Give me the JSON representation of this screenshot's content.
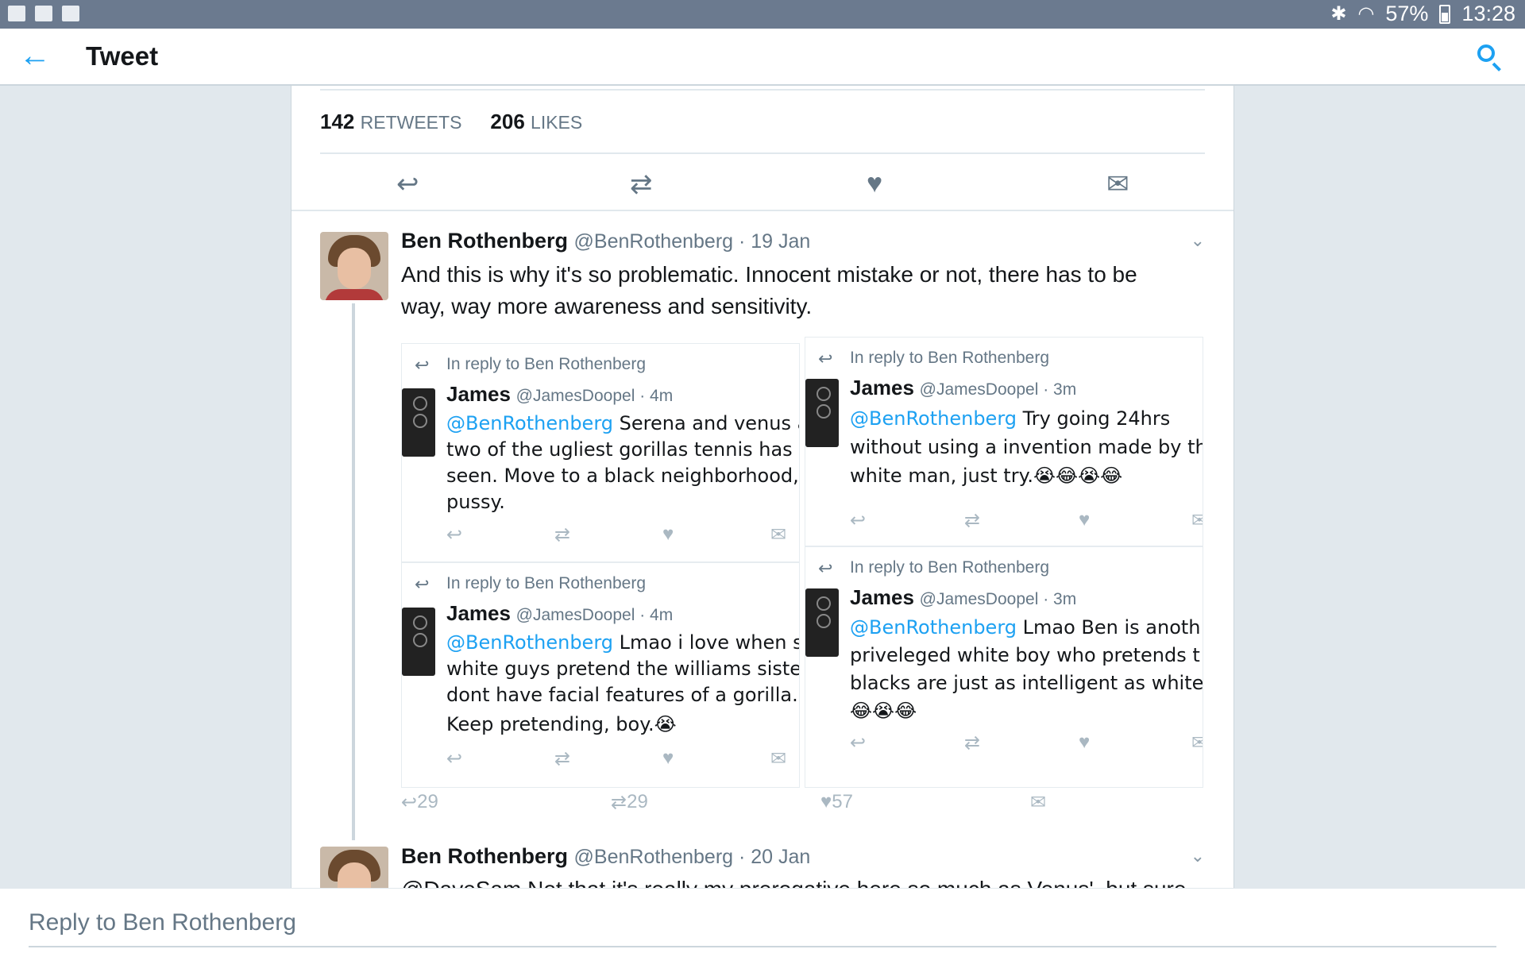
{
  "status_bar": {
    "battery": "57%",
    "time": "13:28"
  },
  "toolbar": {
    "title": "Tweet"
  },
  "stats": {
    "retweets_count": "142",
    "retweets_label": "RETWEETS",
    "likes_count": "206",
    "likes_label": "LIKES"
  },
  "reply_1": {
    "name": "Ben Rothenberg",
    "handle": "@BenRothenberg · 19 Jan",
    "text_line1": "And this is why it's so problematic. Innocent mistake or not, there has to be",
    "text_line2": "way, way more awareness and sensitivity.",
    "embedded": [
      {
        "reply_to": "In reply to Ben Rothenberg",
        "name": "James",
        "handle": "@JamesDoopel · 4m",
        "mention": "@BenRothenberg",
        "line1": " Serena and venus a",
        "line2": "two of the ugliest gorillas tennis has e",
        "line3": "seen. Move to a black neighborhood,",
        "line4": "pussy."
      },
      {
        "reply_to": "In reply to Ben Rothenberg",
        "name": "James",
        "handle": "@JamesDoopel · 3m",
        "mention": "@BenRothenberg",
        "line1": " Try going 24hrs",
        "line2": "without using a invention made by th",
        "line3": "white man, just try.😭😂😭😂",
        "line4": ""
      },
      {
        "reply_to": "In reply to Ben Rothenberg",
        "name": "James",
        "handle": "@JamesDoopel · 4m",
        "mention": "@BenRothenberg",
        "line1": " Lmao i love when si",
        "line2": "white guys pretend the williams sister",
        "line3": "dont have facial features of a gorilla.",
        "line4": "Keep pretending, boy.😭"
      },
      {
        "reply_to": "In reply to Ben Rothenberg",
        "name": "James",
        "handle": "@JamesDoopel · 3m",
        "mention": "@BenRothenberg",
        "line1": " Lmao Ben is anoth",
        "line2": "priveleged white boy who pretends t",
        "line3": "blacks are just as intelligent as white",
        "line4": "😂😭😂"
      }
    ],
    "actions": {
      "replies": "29",
      "retweets": "29",
      "likes": "57"
    }
  },
  "reply_2": {
    "name": "Ben Rothenberg",
    "handle": "@BenRothenberg · 20 Jan",
    "text_partial": "@DaveSam Not that it's really my prerogative here so much as Venus', but sure"
  },
  "reply_bar": {
    "placeholder": "Reply to Ben Rothenberg"
  },
  "icons": {
    "back": "arrow-left",
    "search": "magnifier",
    "reply": "reply-arrow",
    "retweet": "retweet-arrows",
    "like": "heart",
    "dm": "envelope",
    "chevron": "chevron-down"
  },
  "colors": {
    "accent": "#1da1f2",
    "status_bar": "#6b7a8f",
    "muted": "#657786"
  }
}
